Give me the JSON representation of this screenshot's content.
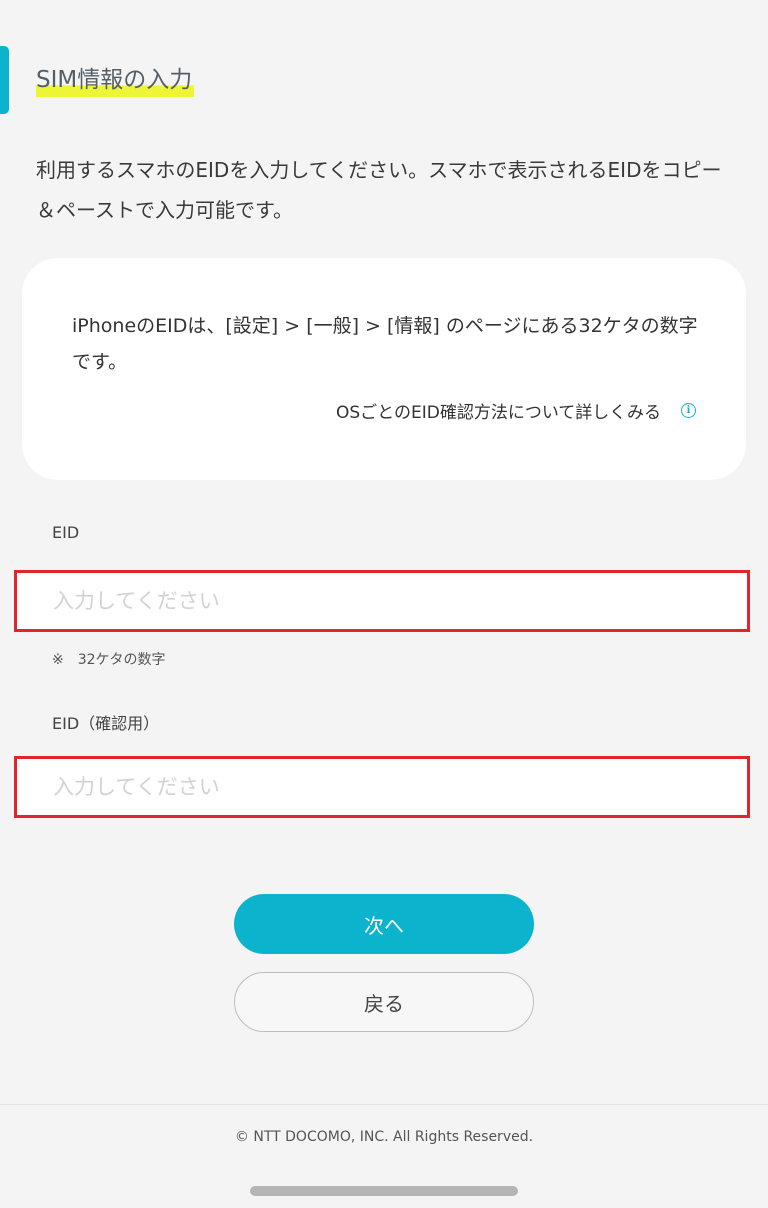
{
  "header": {
    "title": "SIM情報の入力"
  },
  "intro": {
    "text": "利用するスマホのEIDを入力してください。スマホで表示されるEIDをコピー＆ペーストで入力可能です。"
  },
  "info_card": {
    "text": "iPhoneのEIDは、[設定] > [一般] > [情報] のページにある32ケタの数字です。",
    "link_label": "OSごとのEID確認方法について詳しくみる",
    "link_icon": "info-icon"
  },
  "form": {
    "eid": {
      "label": "EID",
      "value": "",
      "placeholder": "入力してください",
      "hint": "※　32ケタの数字"
    },
    "eid_confirm": {
      "label": "EID（確認用）",
      "value": "",
      "placeholder": "入力してください"
    }
  },
  "actions": {
    "next_label": "次へ",
    "back_label": "戻る"
  },
  "footer": {
    "copyright": "© NTT DOCOMO, INC. All Rights Reserved."
  },
  "colors": {
    "accent": "#0bb4cc",
    "highlight": "#eef436",
    "error_border": "#e0262d",
    "background": "#f4f4f4"
  }
}
